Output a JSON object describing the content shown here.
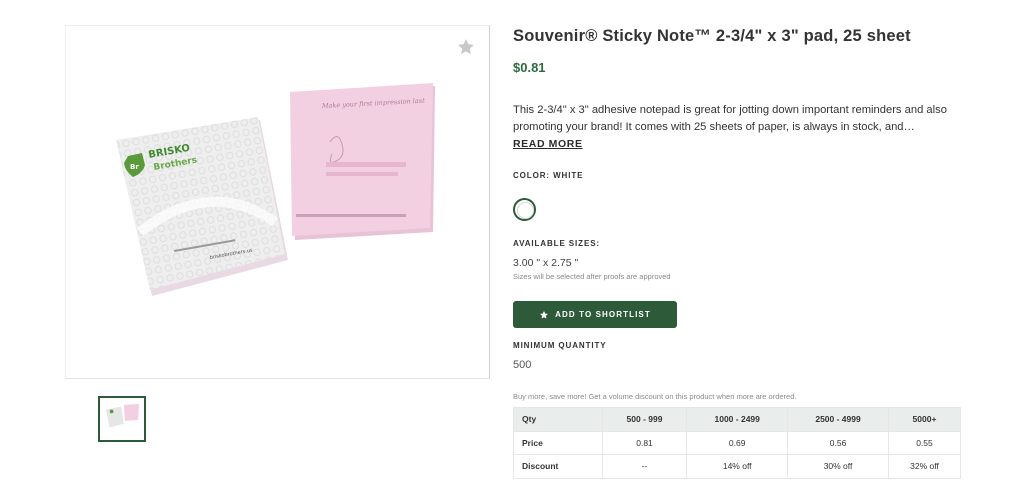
{
  "product": {
    "title": "Souvenir® Sticky Note™ 2-3/4\" x 3\" pad, 25 sheet",
    "price": "$0.81",
    "description": "This 2-3/4\" x 3\" adhesive notepad is great for jotting down important reminders and also promoting your brand! It comes with 25 sheets of paper, is always in stock, and…",
    "read_more": "READ MORE"
  },
  "gallery": {
    "favorite_icon": "star-icon",
    "image_text": {
      "brand_line1": "BRISKO",
      "brand_line2": "Brothers",
      "website": "briskobrothers.us",
      "tagline": "Make your first impression last"
    }
  },
  "options": {
    "color_label": "COLOR: WHITE",
    "color_swatch": "#ffffff",
    "sizes_label": "AVAILABLE SIZES:",
    "size_value": "3.00 \" x 2.75 \"",
    "size_note": "Sizes will be selected after proofs are approved"
  },
  "actions": {
    "shortlist_label": "ADD TO SHORTLIST",
    "shortlist_icon": "star-icon"
  },
  "minimum": {
    "label": "MINIMUM QUANTITY",
    "value": "500"
  },
  "volume": {
    "promo": "Buy more, save more! Get a volume discount on this product when more are ordered.",
    "headers": [
      "Qty",
      "500 - 999",
      "1000 - 2499",
      "2500 - 4999",
      "5000+"
    ],
    "rows": [
      [
        "Price",
        "0.81",
        "0.69",
        "0.56",
        "0.55"
      ],
      [
        "Discount",
        "--",
        "14% off",
        "30% off",
        "32% off"
      ]
    ]
  },
  "colors": {
    "accent": "#2d5a39",
    "price": "#2d6a3f",
    "table_header": "#e9edeb"
  }
}
